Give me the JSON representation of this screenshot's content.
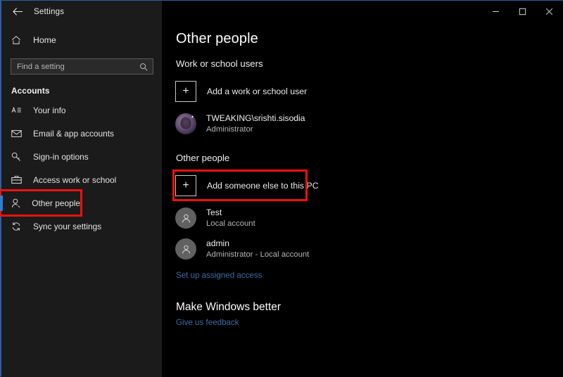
{
  "window": {
    "title": "Settings",
    "back_icon": "back-arrow-icon",
    "controls": {
      "minimize": "minimize-icon",
      "maximize": "maximize-icon",
      "close": "close-icon"
    }
  },
  "sidebar": {
    "home": {
      "label": "Home",
      "icon": "home-icon"
    },
    "search": {
      "placeholder": "Find a setting",
      "value": "",
      "icon": "search-icon"
    },
    "category": "Accounts",
    "items": [
      {
        "label": "Your info",
        "icon": "your-info-icon",
        "selected": false,
        "highlighted": false
      },
      {
        "label": "Email & app accounts",
        "icon": "envelope-icon",
        "selected": false,
        "highlighted": false
      },
      {
        "label": "Sign-in options",
        "icon": "key-icon",
        "selected": false,
        "highlighted": false
      },
      {
        "label": "Access work or school",
        "icon": "briefcase-icon",
        "selected": false,
        "highlighted": false
      },
      {
        "label": "Other people",
        "icon": "person-icon",
        "selected": true,
        "highlighted": true
      },
      {
        "label": "Sync your settings",
        "icon": "sync-icon",
        "selected": false,
        "highlighted": false
      }
    ]
  },
  "main": {
    "page_title": "Other people",
    "work_section": {
      "heading": "Work or school users",
      "add_button": {
        "label": "Add a work or school user",
        "icon": "plus-icon"
      },
      "accounts": [
        {
          "name": "TWEAKING\\srishti.sisodia",
          "subtitle": "Administrator",
          "avatar": "user-photo-avatar"
        }
      ]
    },
    "other_section": {
      "heading": "Other people",
      "add_button": {
        "label": "Add someone else to this PC",
        "icon": "plus-icon",
        "highlighted": true
      },
      "accounts": [
        {
          "name": "Test",
          "subtitle": "Local account",
          "avatar": "generic-person-avatar"
        },
        {
          "name": "admin",
          "subtitle": "Administrator - Local account",
          "avatar": "generic-person-avatar"
        }
      ],
      "assigned_access_link": "Set up assigned access"
    },
    "feedback_section": {
      "heading": "Make Windows better",
      "link": "Give us feedback"
    }
  },
  "colors": {
    "accent_blue": "#2f7fd0",
    "link_blue": "#3a6ea5",
    "highlight_red": "#ee1111",
    "sidebar_bg": "#1b1b1b",
    "main_bg": "#000000"
  }
}
